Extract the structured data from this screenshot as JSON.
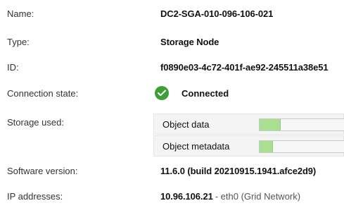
{
  "fields": {
    "name": {
      "label": "Name:",
      "value": "DC2-SGA-010-096-106-021"
    },
    "type": {
      "label": "Type:",
      "value": "Storage Node"
    },
    "id": {
      "label": "ID:",
      "value": "f0890e03-4c72-401f-ae92-245511a38e51"
    },
    "connection": {
      "label": "Connection state:",
      "value": "Connected",
      "icon": "check-circle-icon"
    },
    "storage": {
      "label": "Storage used:",
      "items": [
        {
          "label": "Object data",
          "fill_percent": 25
        },
        {
          "label": "Object metadata",
          "fill_percent": 16
        }
      ]
    },
    "software": {
      "label": "Software version:",
      "value": "11.6.0 (build 20210915.1941.afce2d9)"
    },
    "ip": {
      "label": "IP addresses:",
      "value": "10.96.106.21",
      "suffix": "- eth0 (Grid Network)"
    }
  },
  "colors": {
    "success": "#3d9f35",
    "bar_fill": "#a9df91",
    "bar_bg": "#f7f7f7"
  }
}
